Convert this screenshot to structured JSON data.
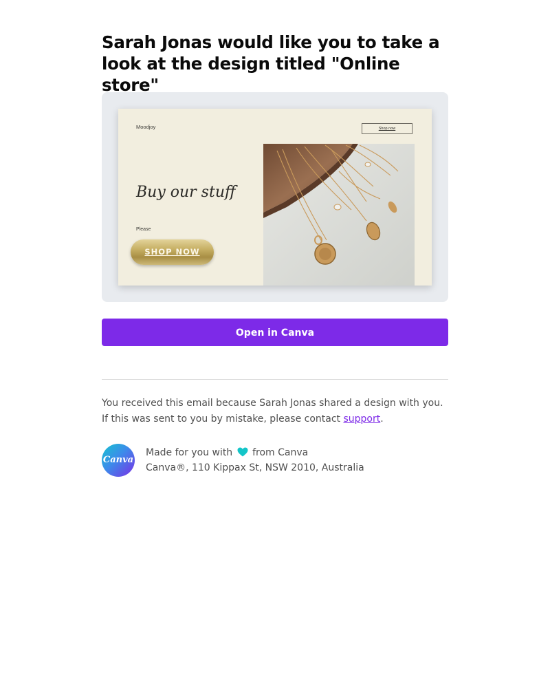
{
  "email": {
    "headline": "Sarah Jonas would like you to take a look at the design titled \"Online store\"",
    "preview": {
      "brand": "Moodjoy",
      "nav_button": "Shop now",
      "headline": "Buy our stuff",
      "subtext": "Please",
      "shop_button": "SHOP NOW",
      "photo_icon": "necklaces-photo-icon"
    },
    "open_button": "Open in Canva",
    "notice": {
      "text": "You received this email because Sarah Jonas shared a design with you. If this was sent to you by mistake, please contact ",
      "link": "support",
      "end": "."
    },
    "footer": {
      "logo_text": "Canva",
      "made_prefix": "Made for you with",
      "made_suffix": "from Canva",
      "heart_icon": "heart-icon",
      "address": "Canva®, 110 Kippax St, NSW 2010, Australia"
    },
    "colors": {
      "accent": "#7d2ae8",
      "heart": "#13c5c8"
    }
  }
}
